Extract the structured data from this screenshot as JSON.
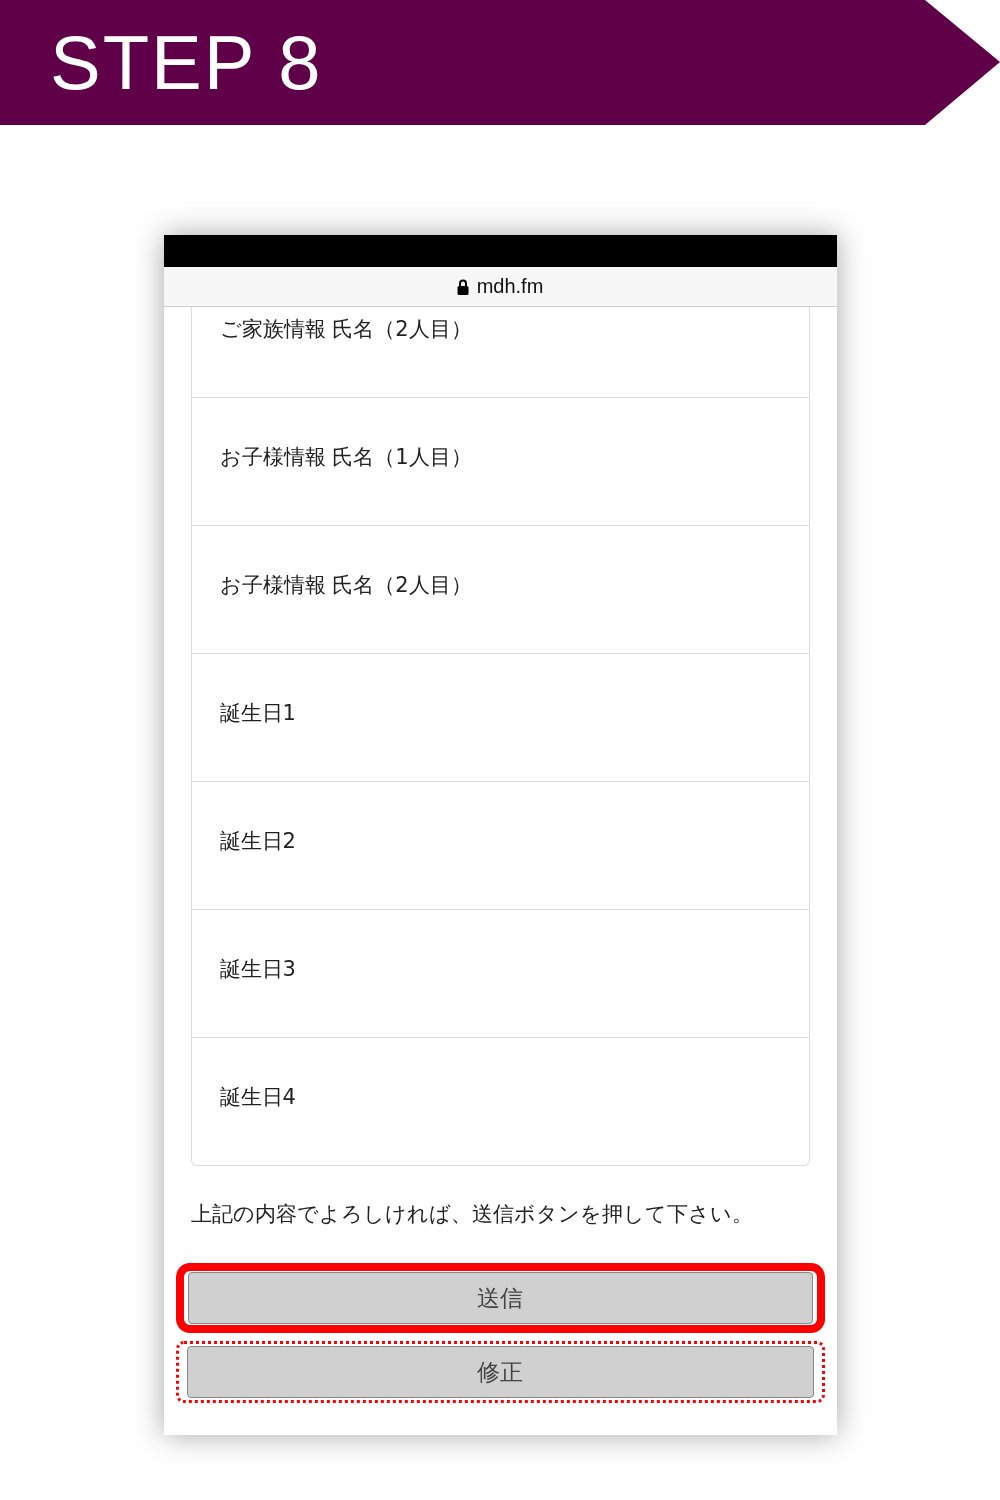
{
  "banner": {
    "title": "STEP 8"
  },
  "browser": {
    "url": "mdh.fm"
  },
  "fields": [
    {
      "label": "ご家族情報 氏名（2人目）"
    },
    {
      "label": "お子様情報 氏名（1人目）"
    },
    {
      "label": "お子様情報 氏名（2人目）"
    },
    {
      "label": "誕生日1"
    },
    {
      "label": "誕生日2"
    },
    {
      "label": "誕生日3"
    },
    {
      "label": "誕生日4"
    }
  ],
  "message": "上記の内容でよろしければ、送信ボタンを押して下さい。",
  "buttons": [
    {
      "label": "送信",
      "kind": "solid"
    },
    {
      "label": "修正",
      "kind": "dotted"
    }
  ]
}
